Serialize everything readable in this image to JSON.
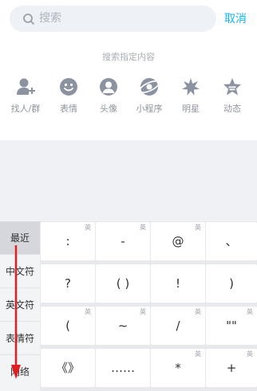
{
  "search": {
    "placeholder": "搜索",
    "cancel_label": "取消"
  },
  "section_hint": "搜索指定内容",
  "shortcuts": [
    {
      "label": "找人/群",
      "icon": "add-person-icon"
    },
    {
      "label": "表情",
      "icon": "smiley-icon"
    },
    {
      "label": "头像",
      "icon": "avatar-icon"
    },
    {
      "label": "小程序",
      "icon": "mini-program-icon"
    },
    {
      "label": "明星",
      "icon": "star-burst-icon"
    },
    {
      "label": "动态",
      "icon": "star-bookmark-icon"
    }
  ],
  "keyboard": {
    "categories": [
      "最近",
      "中文符",
      "英文符",
      "表情符",
      "网络"
    ],
    "active_category": "最近",
    "keys": [
      [
        {
          "symbol": ":",
          "hint": "英"
        },
        {
          "symbol": "-",
          "hint": "英"
        },
        {
          "symbol": "@",
          "hint": "英"
        },
        {
          "symbol": "、",
          "hint": ""
        }
      ],
      [
        {
          "symbol": "?",
          "hint": ""
        },
        {
          "symbol": "( )",
          "hint": ""
        },
        {
          "symbol": "!",
          "hint": ""
        },
        {
          "symbol": ")",
          "hint": ""
        }
      ],
      [
        {
          "symbol": "(",
          "hint": "英"
        },
        {
          "symbol": "~",
          "hint": "英"
        },
        {
          "symbol": "/",
          "hint": "英"
        },
        {
          "symbol": "\"\"",
          "hint": "英"
        }
      ],
      [
        {
          "symbol": "《》",
          "hint": ""
        },
        {
          "symbol": "……",
          "hint": ""
        },
        {
          "symbol": "*",
          "hint": "英"
        },
        {
          "symbol": "+",
          "hint": "英"
        }
      ]
    ]
  },
  "colors": {
    "accent": "#12b7f5",
    "icon_gray": "#8c93a0",
    "annotation_red": "#e02020"
  }
}
